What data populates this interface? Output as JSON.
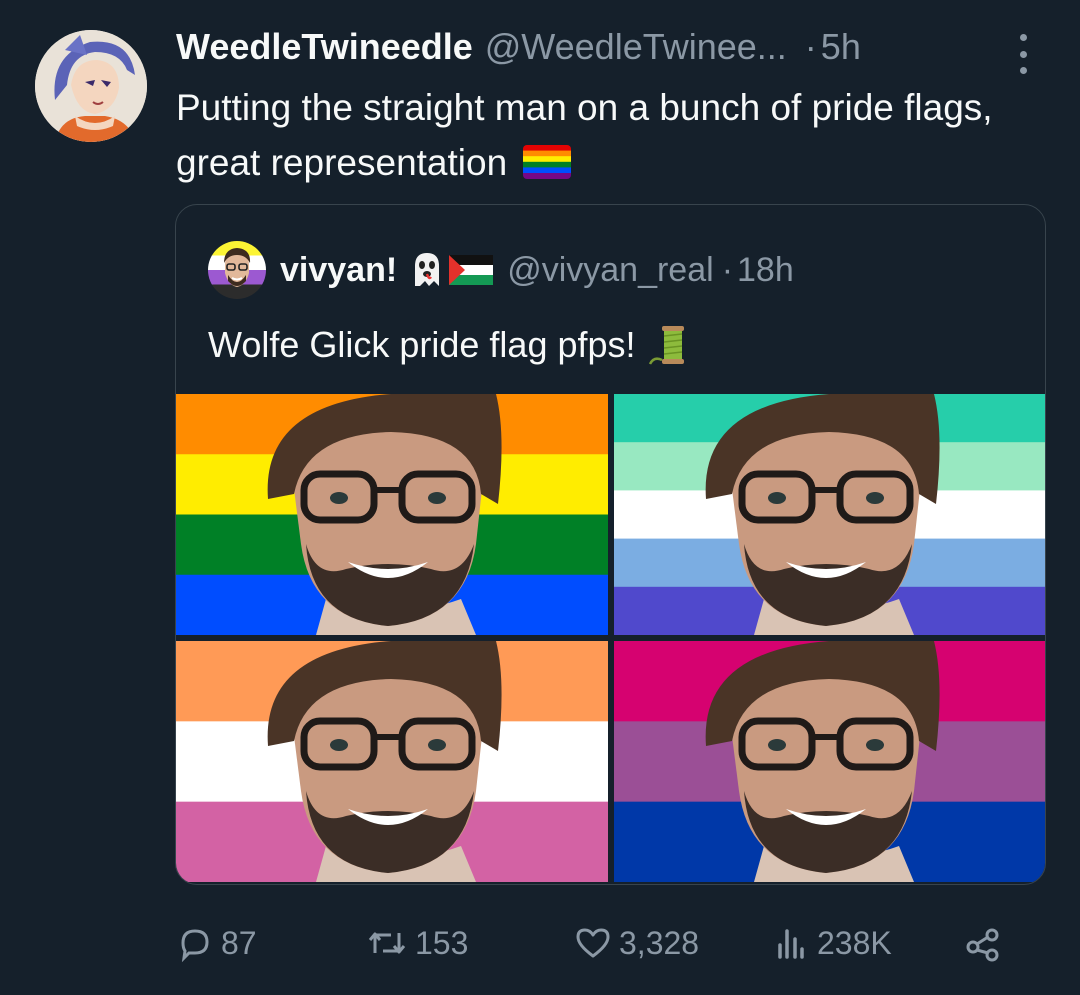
{
  "tweet": {
    "display_name": "WeedleTwineedle",
    "handle": "@WeedleTwinee...",
    "dot": "·",
    "time": "5h",
    "text": "Putting the straight man on a bunch of pride flags, great representation",
    "avatar_icon": "anime-character-avatar",
    "emoji": "rainbow-flag-emoji"
  },
  "quote": {
    "display_name": "vivyan!",
    "handle": "@vivyan_real",
    "dot": "·",
    "time": "18h",
    "text": "Wolfe Glick pride flag pfps!",
    "name_emojis": [
      "ghost-emoji",
      "palestine-flag-emoji"
    ],
    "text_emoji": "thread-spool-emoji",
    "media": [
      {
        "name": "rainbow-flag-pfp",
        "stripes": [
          "#ff8c00",
          "#ffed00",
          "#008026",
          "#004dff"
        ]
      },
      {
        "name": "mlm-flag-pfp",
        "stripes": [
          "#26ceaa",
          "#98e8c1",
          "#ffffff",
          "#7bade2",
          "#5049cc"
        ]
      },
      {
        "name": "lesbian-flag-pfp",
        "stripes": [
          "#ff9a56",
          "#ffffff",
          "#d362a4"
        ]
      },
      {
        "name": "bisexual-flag-pfp",
        "stripes": [
          "#d60270",
          "#9b4f96",
          "#0038a8"
        ]
      }
    ]
  },
  "actions": {
    "replies": "87",
    "reposts": "153",
    "likes": "3,328",
    "views": "238K"
  },
  "colors": {
    "background": "#15202b",
    "text_primary": "#f7f9f9",
    "text_secondary": "#8b98a5",
    "border": "#38444d"
  }
}
